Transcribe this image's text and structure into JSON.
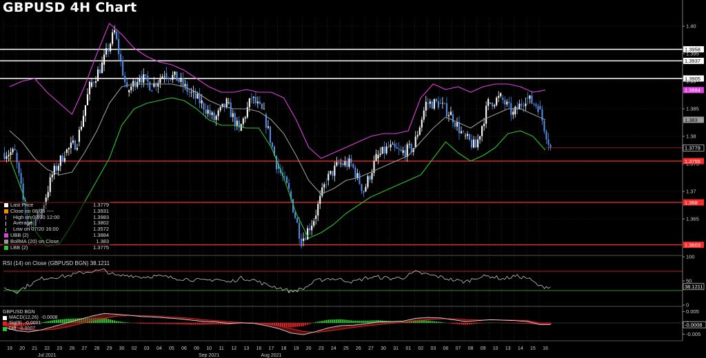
{
  "title": "GBPUSD 4H Chart",
  "colors": {
    "bg": "#000000",
    "up": "#ffffff",
    "down": "#4f8ee8",
    "ubb": "#e040e0",
    "lbb": "#2ec52e",
    "boll": "#9a9a9a",
    "grid": "#3a3a3a",
    "white_line": "#ffffff",
    "red_line": "#ff2a2a",
    "rsi": "#c8c8c8",
    "macd": "#d9d9d9",
    "signal": "#e02020",
    "diff_pos": "#2ec52e",
    "diff_neg": "#e02020"
  },
  "legend": [
    {
      "label": "Last Price",
      "value": "1.3779",
      "color": "#ffffff",
      "icon": "white-square"
    },
    {
      "label": "Close on 08/05 ----",
      "value": "1.3931",
      "color": "#f08c00",
      "icon": "orange-square"
    },
    {
      "label": "High on 07/30 12:00",
      "value": "1.3983",
      "color": "",
      "icon": "up-tick"
    },
    {
      "label": "Average",
      "value": "1.3802",
      "color": "",
      "icon": "dash"
    },
    {
      "label": "Low on 07/20 16:00",
      "value": "1.3572",
      "color": "",
      "icon": "down-tick"
    },
    {
      "label": "UBB (2)",
      "value": "1.3884",
      "color": "#e040e0",
      "icon": "magenta-square"
    },
    {
      "label": "BollMA (20)  on Close",
      "value": "1.383",
      "color": "#9a9a9a",
      "icon": "grey-square"
    },
    {
      "label": "LBB (2)",
      "value": "1.3775",
      "color": "#2ec52e",
      "icon": "green-square"
    }
  ],
  "rsi_label": "RSI (14)  on Close (GBPUSD BGN) 38.1211",
  "macd_title": "GBPUSD BGN",
  "macd_legend": [
    {
      "label": "MACD(12,26)",
      "value": "-0.0008",
      "color": "#ffffff"
    },
    {
      "label": "Sig(9)",
      "value": "-0.0001",
      "color": "#e02020"
    },
    {
      "label": "Diff",
      "value": "-0.0007",
      "color": "#2ec52e"
    }
  ],
  "chart_data": [
    {
      "type": "candlestick",
      "title": "GBPUSD 4H Chart",
      "x_dates": [
        "19",
        "20",
        "21",
        "22",
        "23",
        "26",
        "27",
        "28",
        "29",
        "30",
        "02",
        "03",
        "04",
        "05",
        "06",
        "09",
        "10",
        "11",
        "12",
        "13",
        "16",
        "17",
        "18",
        "19",
        "20",
        "23",
        "24",
        "25",
        "26",
        "27",
        "30",
        "31",
        "01",
        "02",
        "03",
        "06",
        "07",
        "08",
        "09",
        "10",
        "13",
        "14",
        "15",
        "16"
      ],
      "month_labels": [
        {
          "label": "Jul 2021",
          "at": "22"
        },
        {
          "label": "Aug 2021",
          "at": "17"
        },
        {
          "label": "Sep 2021",
          "at": "10"
        }
      ],
      "ylim": [
        1.3585,
        1.4015
      ],
      "y_ticks": [
        "1.40",
        "1.395",
        "1.39",
        "1.385",
        "1.38",
        "1.375",
        "1.37",
        "1.365"
      ],
      "horizontal_lines": [
        {
          "value": 1.3958,
          "color": "white",
          "label": "1.3958"
        },
        {
          "value": 1.3937,
          "color": "white",
          "label": "1.3937"
        },
        {
          "value": 1.3905,
          "color": "white",
          "label": "1.3905"
        },
        {
          "value": 1.3755,
          "color": "red",
          "label": "1.3755"
        },
        {
          "value": 1.368,
          "color": "red",
          "label": "1.368"
        },
        {
          "value": 1.3603,
          "color": "red",
          "label": "1.3603"
        }
      ],
      "price_path_daily_close": [
        1.377,
        1.364,
        1.3655,
        1.373,
        1.377,
        1.379,
        1.389,
        1.393,
        1.399,
        1.388,
        1.391,
        1.389,
        1.3915,
        1.3905,
        1.388,
        1.386,
        1.383,
        1.386,
        1.381,
        1.387,
        1.384,
        1.375,
        1.37,
        1.361,
        1.365,
        1.372,
        1.375,
        1.375,
        1.37,
        1.376,
        1.378,
        1.377,
        1.378,
        1.386,
        1.386,
        1.384,
        1.38,
        1.378,
        1.386,
        1.387,
        1.384,
        1.387,
        1.3855,
        1.3779
      ],
      "ubb_daily": [
        1.389,
        1.39,
        1.3905,
        1.388,
        1.386,
        1.384,
        1.389,
        1.395,
        1.4005,
        1.3985,
        1.396,
        1.3945,
        1.3935,
        1.393,
        1.392,
        1.3905,
        1.389,
        1.388,
        1.388,
        1.3885,
        1.388,
        1.388,
        1.387,
        1.383,
        1.378,
        1.376,
        1.377,
        1.378,
        1.379,
        1.38,
        1.3805,
        1.3805,
        1.381,
        1.387,
        1.3895,
        1.3885,
        1.389,
        1.388,
        1.389,
        1.3895,
        1.3895,
        1.389,
        1.388,
        1.3884
      ],
      "boll_daily": [
        1.381,
        1.379,
        1.376,
        1.374,
        1.373,
        1.3735,
        1.377,
        1.381,
        1.386,
        1.389,
        1.3895,
        1.3895,
        1.3895,
        1.3895,
        1.389,
        1.388,
        1.3865,
        1.3855,
        1.385,
        1.385,
        1.3845,
        1.383,
        1.3805,
        1.3765,
        1.372,
        1.3695,
        1.3705,
        1.372,
        1.3725,
        1.3735,
        1.3745,
        1.3755,
        1.3765,
        1.379,
        1.3815,
        1.3835,
        1.3825,
        1.3815,
        1.383,
        1.384,
        1.385,
        1.385,
        1.384,
        1.383
      ],
      "lbb_daily": [
        1.376,
        1.37,
        1.363,
        1.36,
        1.3605,
        1.364,
        1.368,
        1.372,
        1.376,
        1.382,
        1.385,
        1.386,
        1.3865,
        1.387,
        1.3865,
        1.385,
        1.383,
        1.382,
        1.382,
        1.3815,
        1.3815,
        1.378,
        1.3725,
        1.366,
        1.3615,
        1.3625,
        1.364,
        1.366,
        1.3675,
        1.369,
        1.37,
        1.371,
        1.372,
        1.373,
        1.376,
        1.379,
        1.377,
        1.3755,
        1.3765,
        1.378,
        1.3805,
        1.381,
        1.38,
        1.3775
      ],
      "last_price": 1.3779,
      "value_labels": [
        {
          "label": "1.3884",
          "value": 1.3884,
          "color": "magenta"
        },
        {
          "label": "1.383",
          "value": 1.383,
          "color": "grey"
        },
        {
          "label": "1.3779",
          "value": 1.3779,
          "color": "white"
        }
      ]
    },
    {
      "type": "line",
      "name": "RSI (14)",
      "ylim": [
        0,
        100
      ],
      "y_ticks": [
        "100",
        "50",
        "0"
      ],
      "levels": [
        70,
        30
      ],
      "last_value": "38.1211",
      "values_daily": [
        35,
        28,
        42,
        55,
        58,
        60,
        66,
        70,
        72,
        60,
        62,
        58,
        60,
        58,
        55,
        53,
        50,
        54,
        47,
        56,
        52,
        42,
        36,
        28,
        34,
        50,
        55,
        53,
        48,
        56,
        58,
        55,
        57,
        68,
        63,
        58,
        52,
        48,
        58,
        60,
        54,
        60,
        56,
        38
      ]
    },
    {
      "type": "line",
      "name": "MACD",
      "ylim": [
        -0.007,
        0.007
      ],
      "y_ticks": [
        "0.005",
        "0",
        "-0.005"
      ],
      "last_value": "-0.0008",
      "macd_daily": [
        -0.002,
        -0.0035,
        -0.004,
        -0.003,
        -0.0015,
        0.0,
        0.0015,
        0.003,
        0.0042,
        0.0038,
        0.0034,
        0.0028,
        0.0026,
        0.0022,
        0.0018,
        0.0012,
        0.0006,
        0.0004,
        -0.0002,
        0.0,
        -0.0002,
        -0.0012,
        -0.0025,
        -0.0045,
        -0.0052,
        -0.0038,
        -0.0022,
        -0.0012,
        -0.001,
        -0.0004,
        0.0004,
        0.0006,
        0.0008,
        0.002,
        0.0024,
        0.0022,
        0.0014,
        0.0006,
        0.001,
        0.0014,
        0.0012,
        0.001,
        0.0006,
        -0.0008
      ],
      "signal_daily": [
        -0.001,
        -0.002,
        -0.003,
        -0.0032,
        -0.0028,
        -0.0018,
        -0.0005,
        0.0008,
        0.002,
        0.003,
        0.0033,
        0.0032,
        0.003,
        0.0027,
        0.0024,
        0.002,
        0.0014,
        0.001,
        0.0005,
        0.0002,
        0.0,
        -0.0005,
        -0.0012,
        -0.0025,
        -0.0038,
        -0.0042,
        -0.0036,
        -0.0028,
        -0.002,
        -0.0014,
        -0.0008,
        -0.0002,
        0.0002,
        0.0008,
        0.0014,
        0.0018,
        0.0018,
        0.0015,
        0.0013,
        0.0013,
        0.0013,
        0.0012,
        0.001,
        -0.0001
      ]
    }
  ]
}
